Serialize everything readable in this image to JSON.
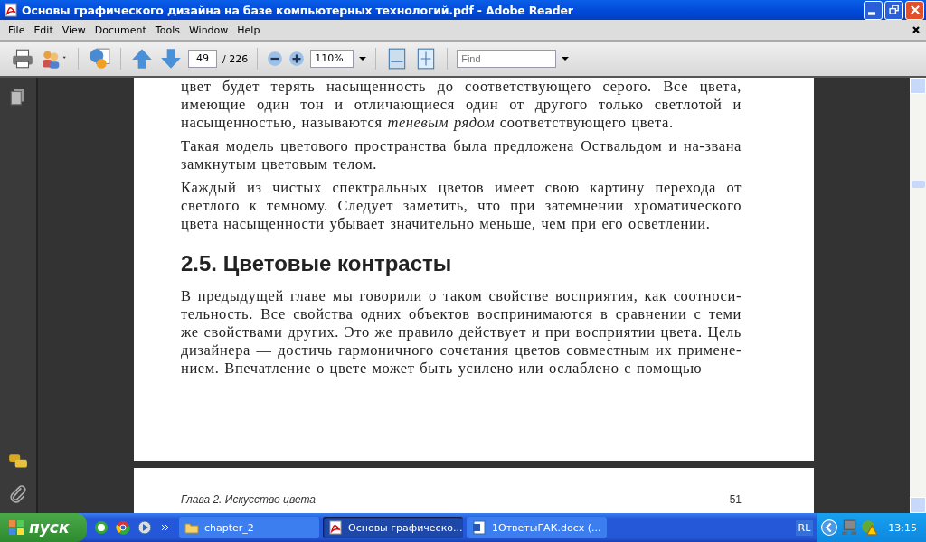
{
  "window": {
    "title": "Основы графического дизайна на базе компьютерных технологий.pdf - Adobe Reader"
  },
  "menu": [
    "File",
    "Edit",
    "View",
    "Document",
    "Tools",
    "Window",
    "Help"
  ],
  "toolbar": {
    "page_number": "49",
    "page_total": "/ 226",
    "zoom": "110%",
    "find": {
      "placeholder": "Find"
    }
  },
  "page": {
    "paragraphs": [
      {
        "kind": "continued",
        "text": "цвет будет терять насыщенность до соответствующего серого. Все цвета, имеющие один тон и отличающиеся один от другого только светлотой и насыщенностью, называются *теневым рядом* соответствующего цвета."
      },
      {
        "kind": "paragraph",
        "text": "Такая модель цветового пространства была предложена Оствальдом и на-звана замкнутым цветовым телом."
      },
      {
        "kind": "paragraph",
        "text": "Каждый из чистых спектральных цветов имеет свою картину перехода от светлого к темному. Следует заметить, что при затемнении хроматического цвета насыщенности убывает значительно меньше, чем при его осветлении."
      },
      {
        "kind": "heading",
        "text": "2.5. Цветовые контрасты"
      },
      {
        "kind": "paragraph",
        "text": "В предыдущей главе мы говорили о таком свойстве восприятия, как соотноси-тельность. Все свойства одних объектов воспринимаются в сравнении с теми же свойствами других. Это же правило действует и при восприятии цвета. Цель дизайнера — достичь гармоничного сочетания цветов совместным их примене-нием. Впечатление о цвете может быть усилено или ослаблено с помощью"
      }
    ]
  },
  "next_page": {
    "running_head": "Глава 2. Искусство цвета",
    "page_number": "51"
  },
  "taskbar": {
    "start": "пуск",
    "tasks": [
      {
        "kind": "folder",
        "label": "chapter_2",
        "selected": false
      },
      {
        "kind": "pdf",
        "label": "Основы графическо...",
        "selected": true
      },
      {
        "kind": "word",
        "label": "1ОтветыГАК.docx (...",
        "selected": false
      }
    ],
    "language": "RL",
    "clock": "13:15"
  }
}
